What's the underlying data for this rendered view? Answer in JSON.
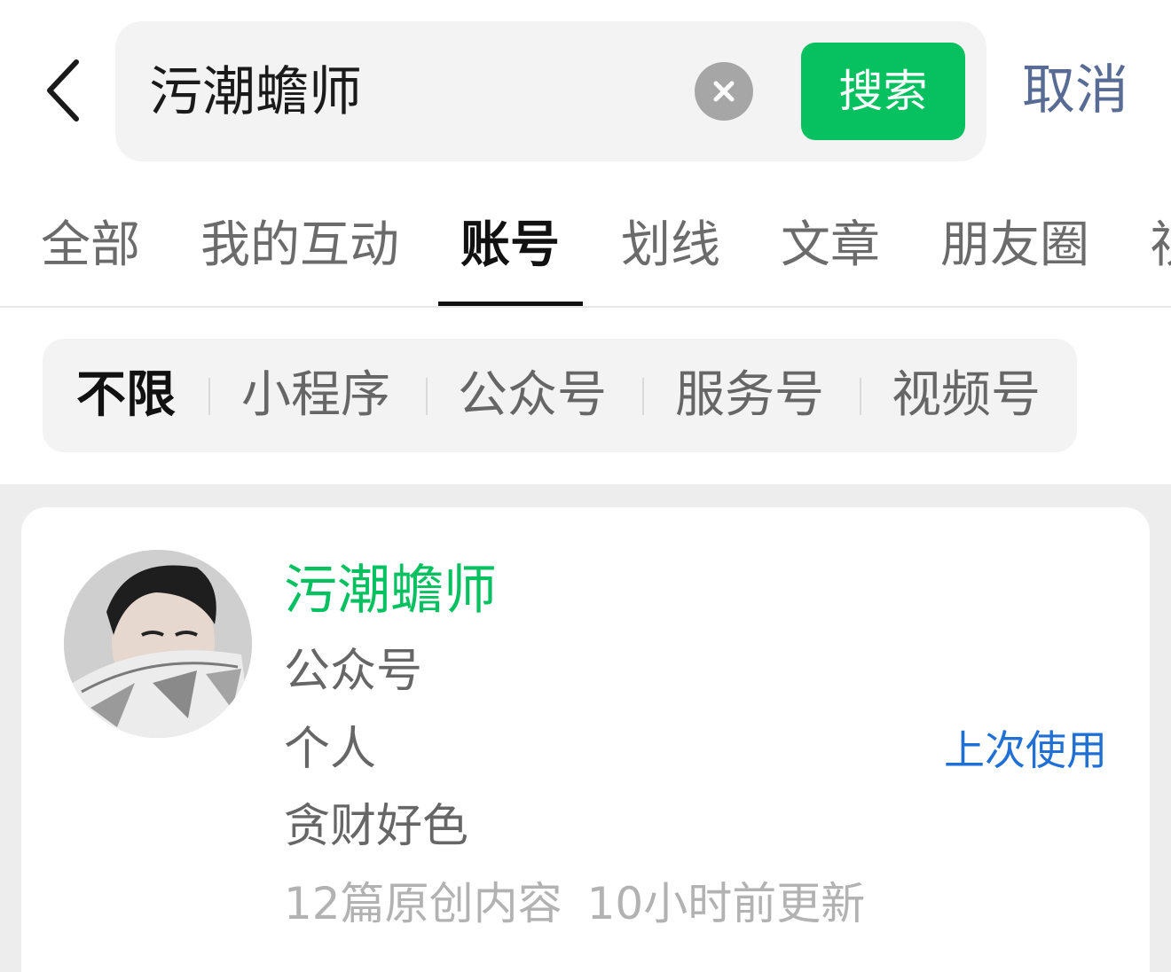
{
  "search": {
    "query": "污潮蟾师",
    "button_label": "搜索",
    "cancel_label": "取消"
  },
  "tabs": [
    {
      "label": "全部"
    },
    {
      "label": "我的互动"
    },
    {
      "label": "账号",
      "active": true
    },
    {
      "label": "划线"
    },
    {
      "label": "文章"
    },
    {
      "label": "朋友圈"
    },
    {
      "label": "视"
    }
  ],
  "filters": [
    {
      "label": "不限",
      "active": true
    },
    {
      "label": "小程序"
    },
    {
      "label": "公众号"
    },
    {
      "label": "服务号"
    },
    {
      "label": "视频号"
    }
  ],
  "result": {
    "name": "污潮蟾师",
    "type": "公众号",
    "category": "个人",
    "bio": "贪财好色",
    "articles": "12篇原创内容",
    "updated": "10小时前更新",
    "last_used": "上次使用"
  },
  "colors": {
    "accent_green": "#07c160",
    "link_blue": "#1f6fd4",
    "cancel_text": "#576b95"
  },
  "icons": {
    "back": "chevron-left-icon",
    "clear": "clear-icon"
  }
}
